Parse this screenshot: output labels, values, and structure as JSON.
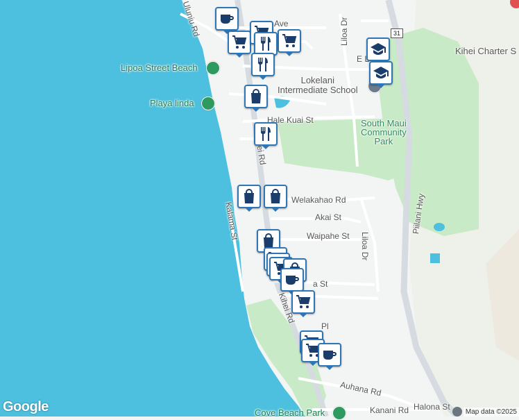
{
  "map": {
    "colors": {
      "ocean": "#4cc0de",
      "land": "#f3f4f4",
      "park": "#c9eac6",
      "road_major": "#d5dbe0",
      "road_minor": "#ffffff",
      "marker_border": "#2e76b5",
      "marker_icon": "#1a3d6b",
      "poi_green": "#1e7d54"
    },
    "streets": {
      "uluniu": "Uluniu Rd",
      "ave": "Ave",
      "liloa_north": "Liloa Dr",
      "hale_kuai": "Hale Kuai St",
      "kihei_north": "hei Rd",
      "welakahao": "Welakahao Rd",
      "akai": "Akai St",
      "kalama": "Kalama St",
      "waipahe": "Waipahe St",
      "liloa_south": "Liloa Dr",
      "piilani": "Piilani Hwy",
      "a_st": "a St",
      "kihei_south": "Kihei Rd",
      "pl": "Pl",
      "auhana": "Auhana Rd",
      "kanani": "Kanani Rd",
      "halona": "Halona St",
      "e_l": "E L",
      "highway_shield": "31"
    },
    "places": {
      "lipoa_beach": "Lipoa Street Beach",
      "playa_linda": "Playa linda",
      "lokelani": "Lokelani\nIntermediate School",
      "kihei_charter": "Kihei Charter S",
      "south_maui_park": "South Maui\nCommunity\nPark",
      "cove_beach_park": "Cove Beach Park"
    },
    "markers": [
      {
        "icon": "coffee-icon"
      },
      {
        "icon": "cart-icon"
      },
      {
        "icon": "cart-icon"
      },
      {
        "icon": "cart-icon"
      },
      {
        "icon": "fork-knife-icon"
      },
      {
        "icon": "fork-knife-icon"
      },
      {
        "icon": "school-icon"
      },
      {
        "icon": "school-icon"
      },
      {
        "icon": "shopping-bag-icon"
      },
      {
        "icon": "fork-knife-icon"
      },
      {
        "icon": "shopping-bag-icon"
      },
      {
        "icon": "shopping-bag-icon"
      },
      {
        "icon": "shopping-bag-icon"
      },
      {
        "icon": "cart-icon"
      },
      {
        "icon": "cart-icon"
      },
      {
        "icon": "cart-icon"
      },
      {
        "icon": "shopping-bag-icon"
      },
      {
        "icon": "coffee-icon"
      },
      {
        "icon": "cart-icon"
      },
      {
        "icon": "cart-icon"
      },
      {
        "icon": "cart-icon"
      },
      {
        "icon": "coffee-icon"
      }
    ],
    "branding": {
      "logo": "Google",
      "attribution": "Map data ©2025"
    }
  }
}
